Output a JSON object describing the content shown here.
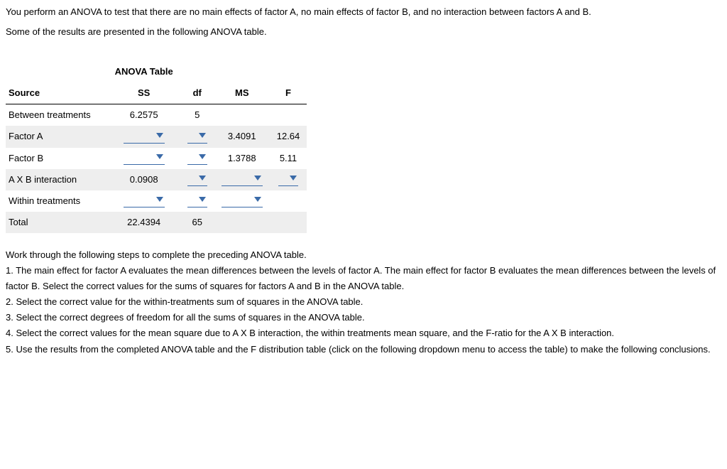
{
  "intro": {
    "line1": "You perform an ANOVA to test that there are no main effects of factor A, no main effects of factor B, and no interaction between factors A and B.",
    "line2": "Some of the results are presented in the following ANOVA table."
  },
  "table": {
    "title": "ANOVA Table",
    "headers": {
      "source": "Source",
      "ss": "SS",
      "df": "df",
      "ms": "MS",
      "f": "F"
    },
    "rows": {
      "between": {
        "source": "Between treatments",
        "ss": "6.2575",
        "df": "5",
        "ms": "",
        "f": ""
      },
      "factorA": {
        "source": "Factor A",
        "ms": "3.4091",
        "f": "12.64"
      },
      "factorB": {
        "source": "Factor B",
        "ms": "1.3788",
        "f": "5.11"
      },
      "interaction": {
        "source": "A X B interaction",
        "ss": "0.0908"
      },
      "within": {
        "source": "Within treatments"
      },
      "total": {
        "source": "Total",
        "ss": "22.4394",
        "df": "65"
      }
    }
  },
  "steps": {
    "lead": "Work through the following steps to complete the preceding ANOVA table.",
    "s1": "1. The main effect for factor A evaluates the mean differences between the levels of factor A. The main effect for factor B evaluates the mean differences between the levels of factor B. Select the correct values for the sums of squares for factors A and B in the ANOVA table.",
    "s2": "2. Select the correct value for the within-treatments sum of squares in the ANOVA table.",
    "s3": "3. Select the correct degrees of freedom for all the sums of squares in the ANOVA table.",
    "s4": "4. Select the correct values for the mean square due to A X B interaction, the within treatments mean square, and the F-ratio for the A X B interaction.",
    "s5": "5. Use the results from the completed ANOVA table and the F distribution table (click on the following dropdown menu to access the table) to make the following conclusions."
  }
}
